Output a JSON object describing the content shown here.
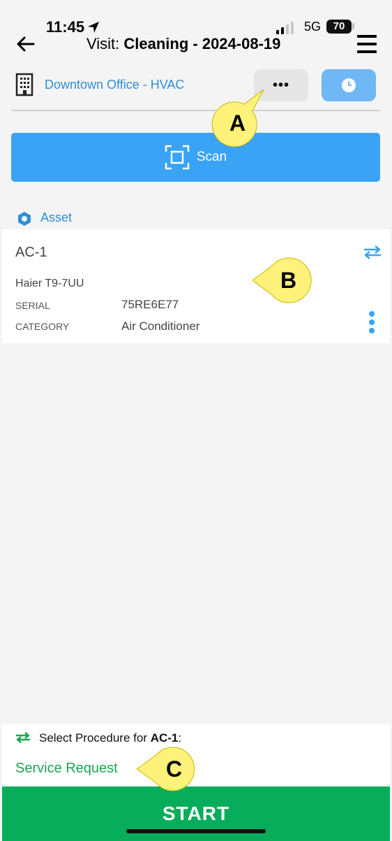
{
  "status_bar": {
    "time": "11:45",
    "network": "5G",
    "battery": "70"
  },
  "header": {
    "title_prefix": "Visit: ",
    "title_bold": "Cleaning - 2024-08-19"
  },
  "location": {
    "name": "Downtown Office - HVAC",
    "more_label": "•••"
  },
  "scan": {
    "label": "Scan"
  },
  "asset_section": {
    "label": "Asset"
  },
  "asset": {
    "name": "AC-1",
    "model": "Haier T9-7UU",
    "fields": [
      {
        "key": "SERIAL",
        "value": "75RE6E77"
      },
      {
        "key": "CATEGORY",
        "value": "Air Conditioner"
      }
    ]
  },
  "procedure": {
    "prompt": "Select Procedure for ",
    "asset_ref": "AC-1",
    "suffix": ":",
    "option": "Service Request"
  },
  "start": {
    "label": "START"
  },
  "callouts": {
    "a": "A",
    "b": "B",
    "c": "C"
  },
  "colors": {
    "accent_blue": "#3aa3f5",
    "link_blue": "#2f8fd6",
    "green": "#07ad5a",
    "callout": "#fff27a"
  }
}
